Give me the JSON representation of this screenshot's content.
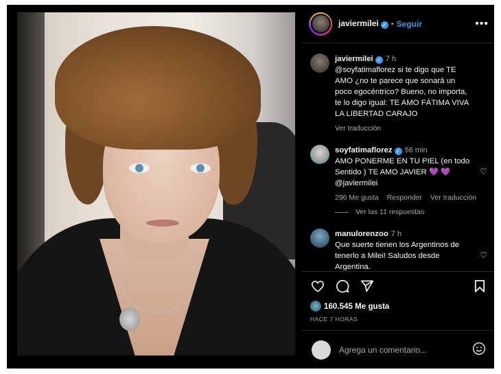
{
  "post": {
    "username": "javiermilei",
    "follow_label": "Seguir",
    "separator": "•"
  },
  "comments": [
    {
      "username": "javiermilei",
      "time": "7 h",
      "text": "@soyfatimaflorez si te digo que TE AMO ¿no te parece que sonará un poco egocéntrico? Bueno, no importa, te lo digo igual: TE AMO FÁTIMA VIVA LA LIBERTAD CARAJO",
      "translate": "Ver traducción"
    },
    {
      "username": "soyfatimaflorez",
      "time": "56 min",
      "text": "AMO PONERME EN TU PIEL (en todo Sentido ) TE AMO JAVIER 💜 💜 @javiermilei",
      "likes": "296 Me gusta",
      "reply": "Responder",
      "translate": "Ver traducción",
      "view_replies": "Ver las 11 respuestas"
    },
    {
      "username": "manulorenzoo",
      "time": "7 h",
      "text": "Que suerte tienen los Argentinos de tenerlo a Milei! Saludos desde Argentina."
    }
  ],
  "stats": {
    "likes": "160.545 Me gusta",
    "ago": "HACE 7 HORAS"
  },
  "add_comment": {
    "placeholder": "Agrega un comentario..."
  },
  "icons": {
    "more": "more-options-icon",
    "like": "heart-icon",
    "comment": "comment-icon",
    "share": "share-icon",
    "save": "bookmark-icon",
    "emoji": "emoji-icon"
  },
  "colors": {
    "background": "#000000",
    "link": "#3897f0",
    "muted": "#a8a8a8",
    "verified": "#3897f0"
  }
}
